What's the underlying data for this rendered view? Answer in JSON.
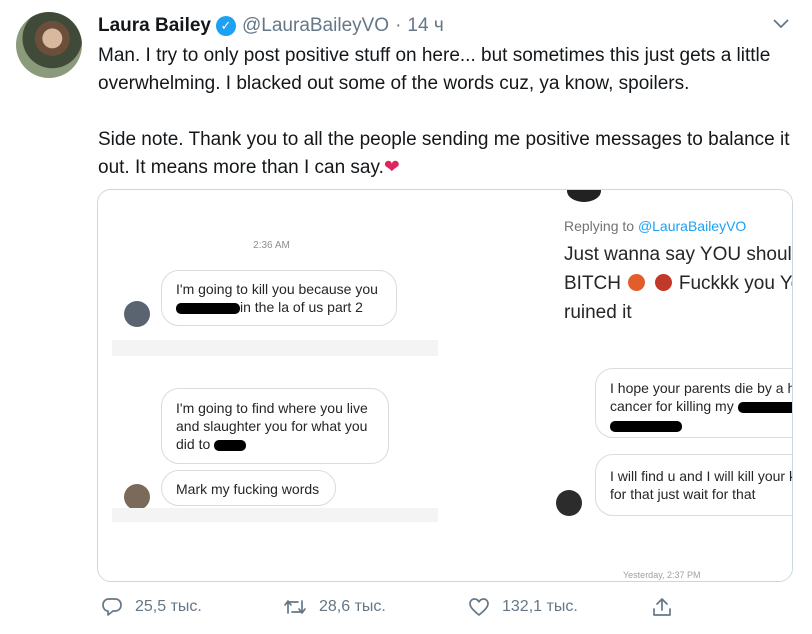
{
  "tweet": {
    "author_name": "Laura Bailey",
    "handle": "@LauraBaileyVO",
    "separator": "·",
    "time": "14 ч",
    "paragraph1": "Man. I try to only post positive stuff on here... but sometimes this just gets a little overwhelming. I blacked out some of the words cuz, ya know, spoilers.",
    "paragraph2": "Side note. Thank you to all the people sending me positive messages to balance it out. It means more than I can say.",
    "heart_emoji": "❤"
  },
  "left_screenshot": {
    "timestamp": "2:36 AM",
    "msg1_line1": "I'm going to kill you because you",
    "msg1_line2_after_censor": "in the la of us part 2",
    "msg2_line1": "I'm going to find where you live",
    "msg2_line2": "and slaughter you for what you",
    "msg2_line3_before_censor": "did to",
    "msg3": "Mark my fucking words"
  },
  "right_screenshot": {
    "replying_prefix": "Replying to",
    "replying_handle": "@LauraBaileyVO",
    "big_line1": "Just wanna say YOU should DIE",
    "big_line2_part1": "BITCH",
    "big_line2_part2": "Fuckkk you You",
    "big_line3": "ruined it",
    "msg1_line1": "I hope your parents die by a hard",
    "msg1_line2_before_censor": "cancer for killing my",
    "msg2_line1": "I will find u and I will kill your kid",
    "msg2_line2": "for that just wait for that",
    "timestamp": "Yesterday, 2:37 PM"
  },
  "actions": {
    "reply_count": "25,5 тыс.",
    "retweet_count": "28,6 тыс.",
    "like_count": "132,1 тыс."
  },
  "icons": {
    "verified": "verified-badge-icon",
    "caret": "chevron-down-icon",
    "reply": "reply-icon",
    "retweet": "retweet-icon",
    "like": "heart-icon",
    "share": "share-icon"
  },
  "colors": {
    "accent": "#1da1f2",
    "text_primary": "#14171a",
    "text_secondary": "#657786",
    "heart": "#e0245e"
  }
}
